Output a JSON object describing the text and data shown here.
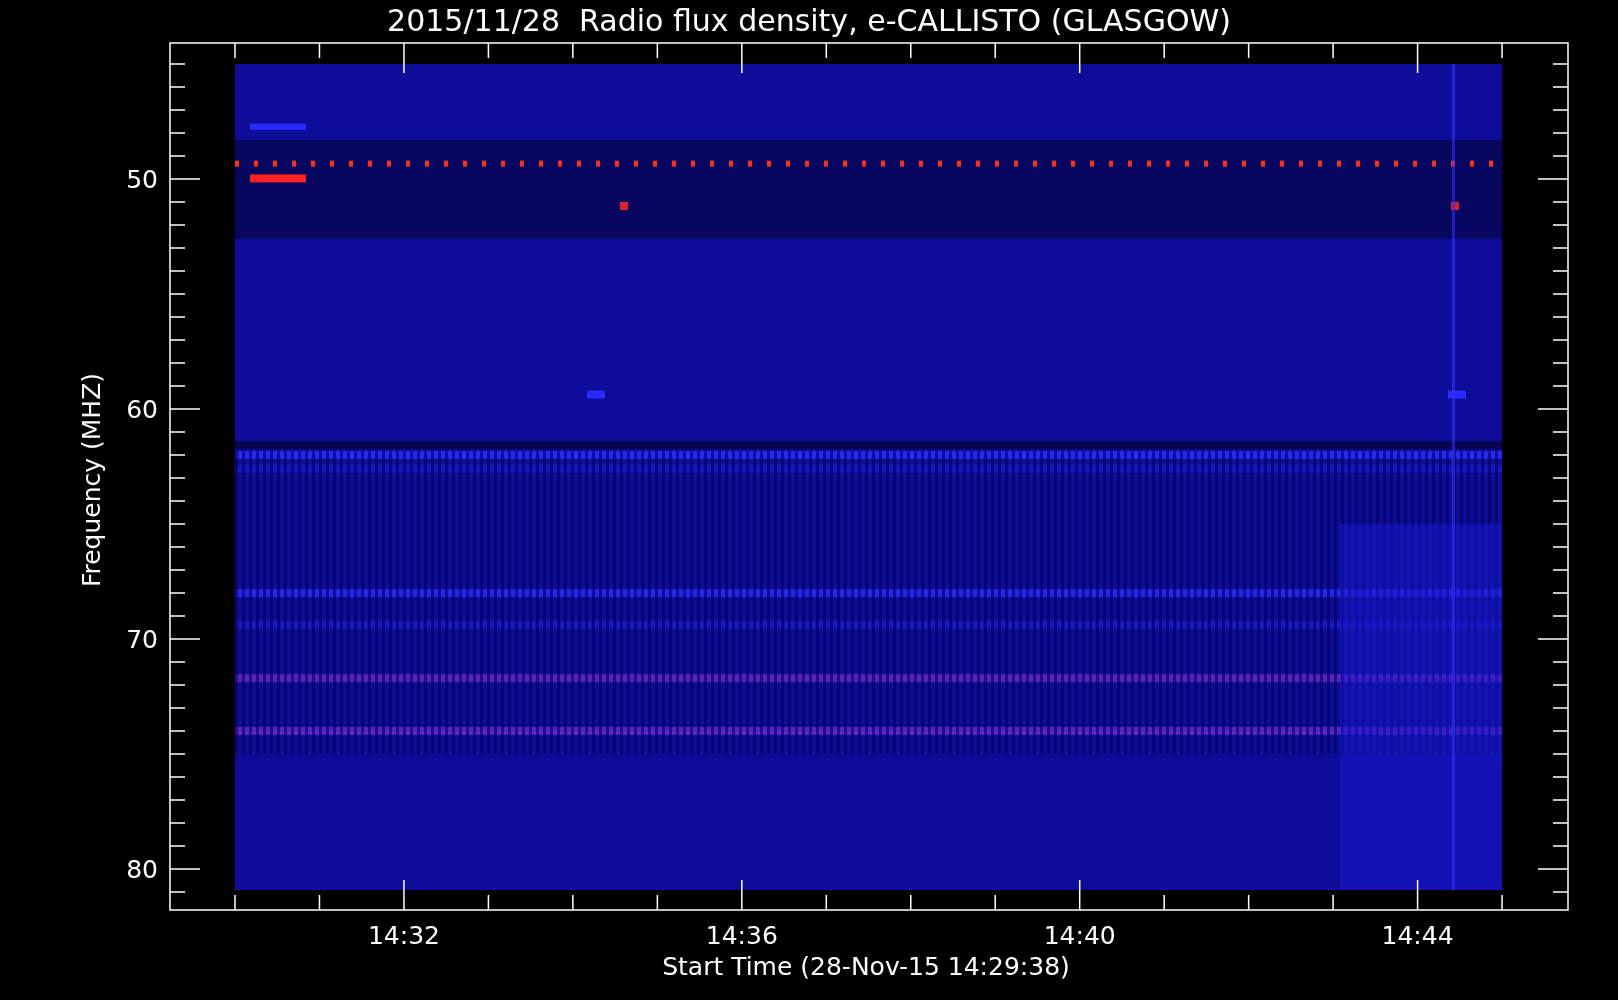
{
  "title": "2015/11/28  Radio flux density, e-CALLISTO (GLASGOW)",
  "y_axis": {
    "label": "Frequency (MHZ)",
    "ticks": [
      "50",
      "60",
      "70",
      "80"
    ]
  },
  "x_axis": {
    "label": "Start Time (28-Nov-15 14:29:38)",
    "ticks": [
      "14:32",
      "14:36",
      "14:40",
      "14:44"
    ]
  }
}
